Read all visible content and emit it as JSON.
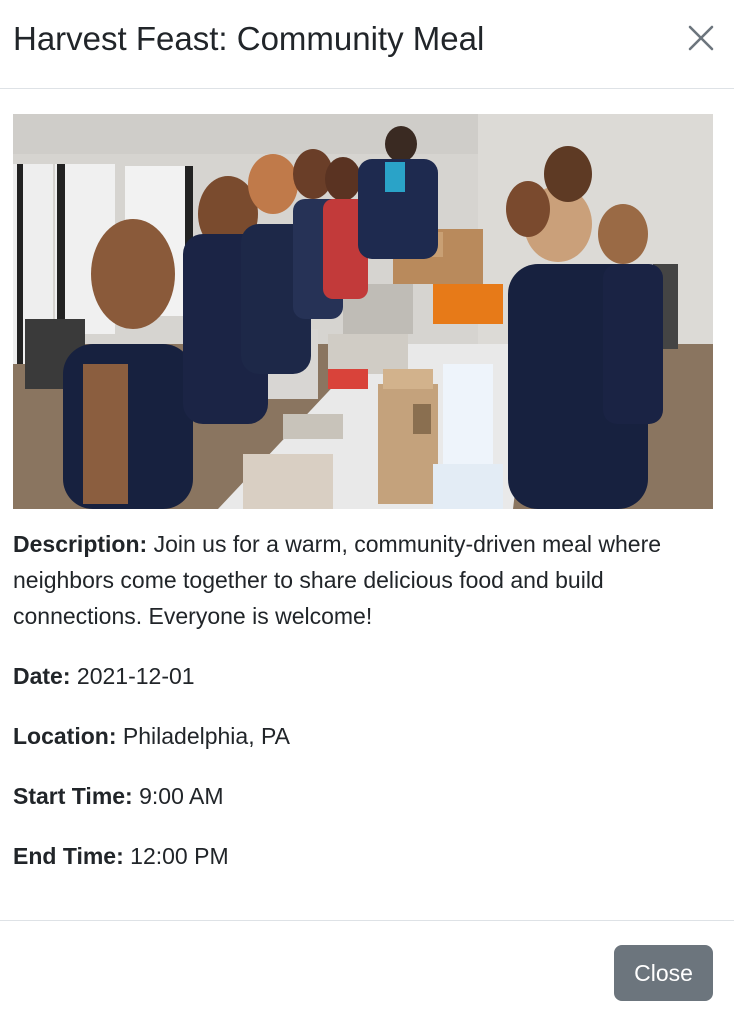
{
  "modal": {
    "title": "Harvest Feast: Community Meal",
    "close_icon": "close-x-icon",
    "image_icon": "event-photo"
  },
  "details": {
    "description_label": "Description:",
    "description_value": "Join us for a warm, community-driven meal where neighbors come together to share delicious food and build connections. Everyone is welcome!",
    "date_label": "Date:",
    "date_value": "2021-12-01",
    "location_label": "Location:",
    "location_value": "Philadelphia, PA",
    "start_label": "Start Time:",
    "start_value": "9:00 AM",
    "end_label": "End Time:",
    "end_value": "12:00 PM"
  },
  "footer": {
    "close_label": "Close"
  },
  "colors": {
    "secondary_button": "#6c757d",
    "divider": "#dee2e6",
    "text": "#212529"
  }
}
